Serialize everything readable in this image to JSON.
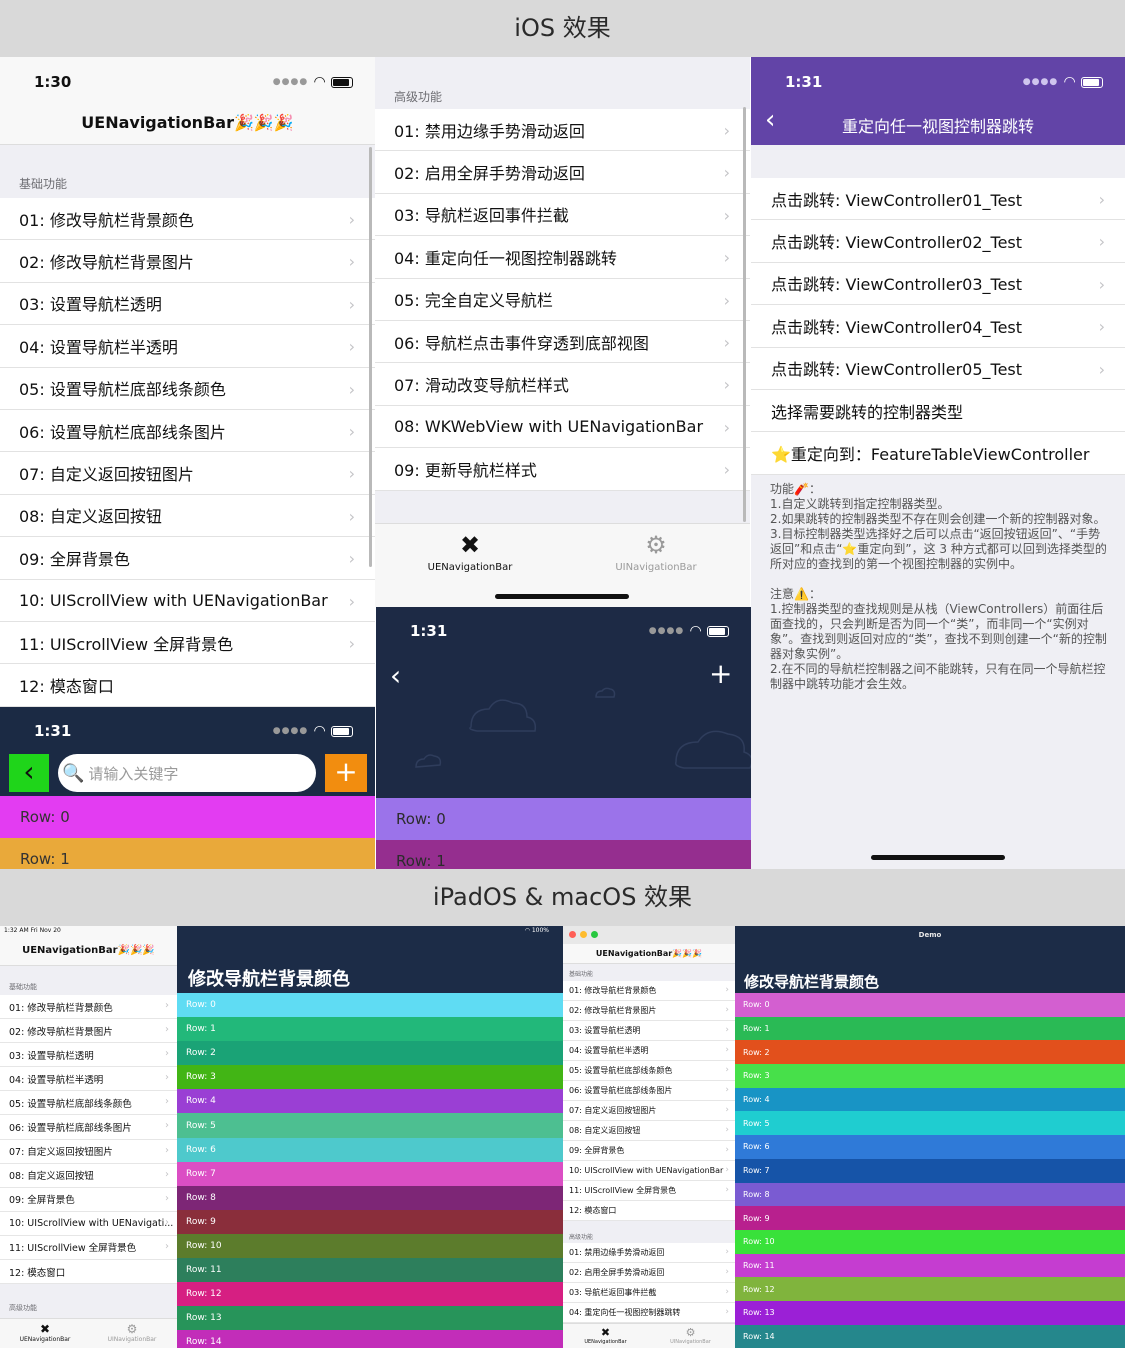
{
  "banners": {
    "ios": "iOS 效果",
    "ipad": "iPadOS & macOS 效果"
  },
  "chevron": "›",
  "time1": "1:30",
  "time2": "1:31",
  "p1": {
    "title": "UENavigationBar🎉🎉🎉",
    "section": "基础功能",
    "items": [
      "01: 修改导航栏背景颜色",
      "02: 修改导航栏背景图片",
      "03: 设置导航栏透明",
      "04: 设置导航栏半透明",
      "05: 设置导航栏底部线条颜色",
      "06: 设置导航栏底部线条图片",
      "07: 自定义返回按钮图片",
      "08: 自定义返回按钮",
      "09: 全屏背景色",
      "10: UIScrollView with UENavigationBar",
      "11: UIScrollView 全屏背景色",
      "12: 模态窗口"
    ]
  },
  "p2": {
    "section": "高级功能",
    "items": [
      "01: 禁用边缘手势滑动返回",
      "02: 启用全屏手势滑动返回",
      "03: 导航栏返回事件拦截",
      "04: 重定向任一视图控制器跳转",
      "05: 完全自定义导航栏",
      "06: 导航栏点击事件穿透到底部视图",
      "07: 滑动改变导航栏样式",
      "08: WKWebView with UENavigationBar",
      "09: 更新导航栏样式"
    ],
    "tabs": [
      "UENavigationBar",
      "UINavigationBar"
    ]
  },
  "p3": {
    "title": "重定向任一视图控制器跳转",
    "items": [
      "点击跳转: ViewController01_Test",
      "点击跳转: ViewController02_Test",
      "点击跳转: ViewController03_Test",
      "点击跳转: ViewController04_Test",
      "点击跳转: ViewController05_Test"
    ],
    "select_type": "选择需要跳转的控制器类型",
    "redirect": "⭐重定向到：FeatureTableViewController",
    "desc1_title": "功能🧨：",
    "desc1": "1.自定义跳转到指定控制器类型。\n2.如果跳转的控制器类型不存在则会创建一个新的控制器对象。\n3.目标控制器类型选择好之后可以点击“返回按钮返回”、“手势返回”和点击“⭐重定向到”，这 3 种方式都可以回到选择类型的所对应的查找到的第一个视图控制器的实例中。",
    "desc2_title": "注意⚠️：",
    "desc2": "1.控制器类型的查找规则是从栈（ViewControllers）前面往后面查找的，只会判断是否为同一个“类”，而非同一个“实例对象”。查找到则返回对应的“类”，查找不到则创建一个“新的控制器对象实例”。\n2.在不同的导航栏控制器之间不能跳转，只有在同一个导航栏控制器中跳转功能才会生效。"
  },
  "p4": {
    "search_placeholder": "请输入关键字",
    "rows": [
      "Row: 0",
      "Row: 1"
    ],
    "row_colors": [
      "#e33cf2",
      "#e9a93a"
    ],
    "back_color": "#1fd51a",
    "add_color": "#f28d0f"
  },
  "p5": {
    "rows": [
      "Row: 0",
      "Row: 1"
    ],
    "row_colors": [
      "#9b73ea",
      "#952e8f"
    ]
  },
  "ipad": {
    "time": "1:32 AM   Fri Nov 20",
    "battery": "100%",
    "title": "UENavigationBar🎉🎉🎉",
    "section1": "基础功能",
    "section2": "高级功能",
    "items": [
      "01: 修改导航栏背景颜色",
      "02: 修改导航栏背景图片",
      "03: 设置导航栏透明",
      "04: 设置导航栏半透明",
      "05: 设置导航栏底部线条颜色",
      "06: 设置导航栏底部线条图片",
      "07: 自定义返回按钮图片",
      "08: 自定义返回按钮",
      "09: 全屏背景色",
      "10: UIScrollView with UENavigati...",
      "11: UIScrollView 全屏背景色",
      "12: 模态窗口"
    ],
    "tabs": [
      "UENavigationBar",
      "UINavigationBar"
    ],
    "detail_title": "修改导航栏背景颜色",
    "rows": [
      "Row: 0",
      "Row: 1",
      "Row: 2",
      "Row: 3",
      "Row: 4",
      "Row: 5",
      "Row: 6",
      "Row: 7",
      "Row: 8",
      "Row: 9",
      "Row: 10",
      "Row: 11",
      "Row: 12",
      "Row: 13",
      "Row: 14"
    ],
    "colors": [
      "#5fdcf3",
      "#22b87a",
      "#1aa376",
      "#42b515",
      "#9a3fd4",
      "#4dbf91",
      "#4ec9cc",
      "#db4ec4",
      "#7d2676",
      "#8a2e3b",
      "#5c7c2c",
      "#2d7f5c",
      "#d61f82",
      "#27945a",
      "#c22db9"
    ]
  },
  "mac": {
    "window_title": "Demo",
    "title": "UENavigationBar🎉🎉🎉",
    "section1": "基础功能",
    "section2": "高级功能",
    "items": [
      "01: 修改导航栏背景颜色",
      "02: 修改导航栏背景图片",
      "03: 设置导航栏透明",
      "04: 设置导航栏半透明",
      "05: 设置导航栏底部线条颜色",
      "06: 设置导航栏底部线条图片",
      "07: 自定义返回按钮图片",
      "08: 自定义返回按钮",
      "09: 全屏背景色",
      "10: UIScrollView with UENavigationBar",
      "11: UIScrollView 全屏背景色",
      "12: 模态窗口"
    ],
    "items2": [
      "01: 禁用边缘手势滑动返回",
      "02: 启用全屏手势滑动返回",
      "03: 导航栏返回事件拦截",
      "04: 重定向任一视图控制器跳转"
    ],
    "tabs": [
      "UENavigationBar",
      "UINavigationBar"
    ],
    "detail_title": "修改导航栏背景颜色",
    "rows": [
      "Row: 0",
      "Row: 1",
      "Row: 2",
      "Row: 3",
      "Row: 4",
      "Row: 5",
      "Row: 6",
      "Row: 7",
      "Row: 8",
      "Row: 9",
      "Row: 10",
      "Row: 11",
      "Row: 12",
      "Row: 13",
      "Row: 14"
    ],
    "colors": [
      "#d35fd0",
      "#2aba55",
      "#e2501c",
      "#47e04a",
      "#1894c5",
      "#1fcdd0",
      "#2f7ad8",
      "#1654a8",
      "#7a5bd2",
      "#b8208e",
      "#39e13a",
      "#c53dd0",
      "#80b43d",
      "#9b20d6",
      "#25878c"
    ]
  }
}
